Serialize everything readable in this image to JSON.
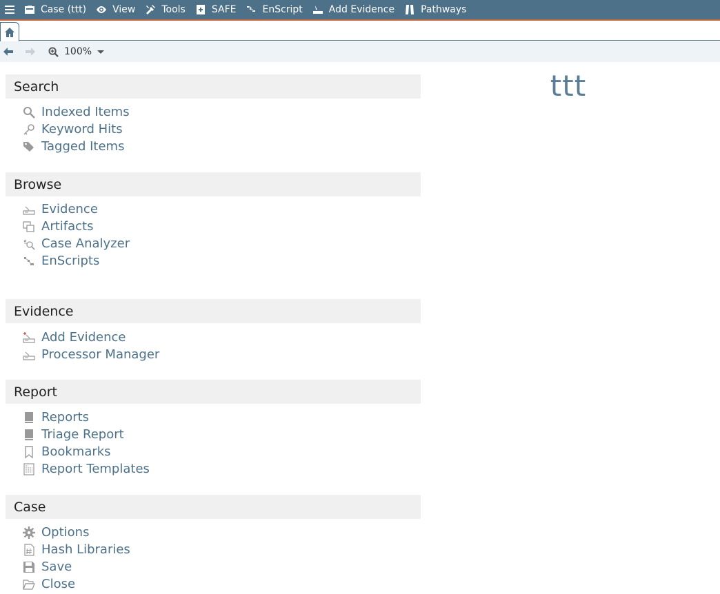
{
  "menubar": {
    "items": [
      {
        "label": "Case (ttt)",
        "icon": "briefcase-icon"
      },
      {
        "label": "View",
        "icon": "eye-icon"
      },
      {
        "label": "Tools",
        "icon": "tools-icon"
      },
      {
        "label": "SAFE",
        "icon": "safe-icon"
      },
      {
        "label": "EnScript",
        "icon": "enscript-icon"
      },
      {
        "label": "Add Evidence",
        "icon": "add-evidence-icon"
      },
      {
        "label": "Pathways",
        "icon": "pathways-icon"
      }
    ]
  },
  "toolbar": {
    "zoom": "100%"
  },
  "sections": {
    "search": {
      "title": "Search",
      "items": [
        "Indexed Items",
        "Keyword Hits",
        "Tagged Items"
      ]
    },
    "browse": {
      "title": "Browse",
      "items": [
        "Evidence",
        "Artifacts",
        "Case Analyzer",
        "EnScripts"
      ]
    },
    "evidence": {
      "title": "Evidence",
      "items": [
        "Add Evidence",
        "Processor Manager"
      ]
    },
    "report": {
      "title": "Report",
      "items": [
        "Reports",
        "Triage Report",
        "Bookmarks",
        "Report Templates"
      ]
    },
    "case": {
      "title": "Case",
      "items": [
        "Options",
        "Hash Libraries",
        "Save",
        "Close"
      ]
    }
  },
  "case_name": "ttt",
  "colors": {
    "menubar": "#4d7189",
    "menubar_accent": "#c9643d",
    "link": "#4d7189",
    "section_header": "#f0f0f0",
    "case_title": "#5b7e96"
  }
}
